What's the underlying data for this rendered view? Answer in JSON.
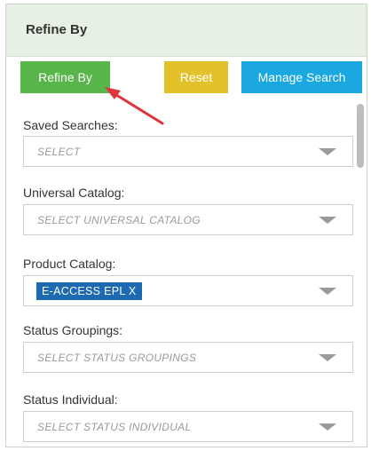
{
  "panel": {
    "title": "Refine By"
  },
  "toolbar": {
    "refine_label": "Refine By",
    "reset_label": "Reset",
    "manage_label": "Manage Search"
  },
  "fields": {
    "saved_searches": {
      "label": "Saved Searches:",
      "placeholder": "SELECT"
    },
    "universal_catalog": {
      "label": "Universal Catalog:",
      "placeholder": "SELECT UNIVERSAL CATALOG"
    },
    "product_catalog": {
      "label": "Product Catalog:",
      "selected_tag": "E-ACCESS EPL X"
    },
    "status_groupings": {
      "label": "Status Groupings:",
      "placeholder": "SELECT STATUS GROUPINGS"
    },
    "status_individual": {
      "label": "Status Individual:",
      "placeholder": "SELECT STATUS INDIVIDUAL"
    }
  },
  "colors": {
    "header_bg": "#e6f1e3",
    "refine_button": "#58b549",
    "reset_button": "#e3c12a",
    "manage_button": "#1ba8e0",
    "tag_bg": "#1d6ab3",
    "annotation_arrow": "#e0333b"
  },
  "icons": {
    "dropdown": "caret-down-icon",
    "annotation": "red-arrow-icon"
  }
}
